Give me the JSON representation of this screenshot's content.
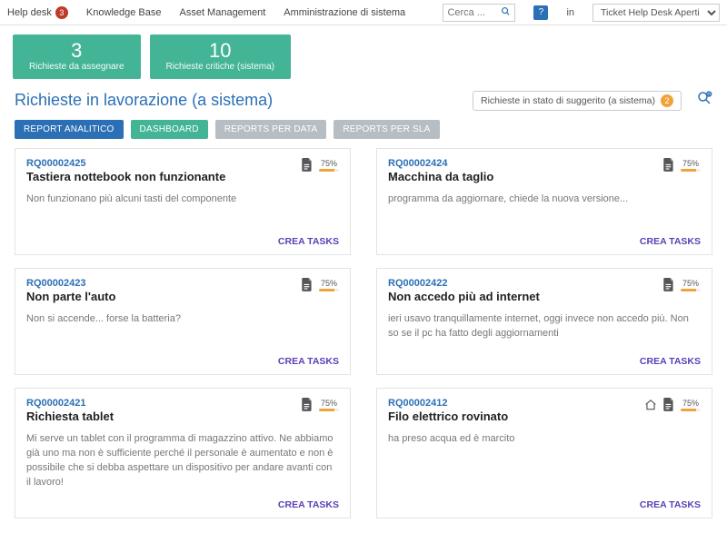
{
  "nav": {
    "items": [
      {
        "label": "Help desk",
        "badge": "3"
      },
      {
        "label": "Knowledge Base"
      },
      {
        "label": "Asset Management"
      },
      {
        "label": "Amministrazione di sistema"
      }
    ],
    "search_placeholder": "Cerca ...",
    "help_label": "?",
    "in_label": "in",
    "scope_value": "Ticket Help Desk Aperti"
  },
  "summary": [
    {
      "value": "3",
      "label": "Richieste da assegnare"
    },
    {
      "value": "10",
      "label": "Richieste critiche (sistema)"
    }
  ],
  "section": {
    "title": "Richieste in lavorazione (a sistema)",
    "suggerito_label": "Richieste in stato di suggerito (a sistema)",
    "suggerito_count": "2"
  },
  "tabs": [
    {
      "label": "REPORT ANALITICO",
      "kind": "blue"
    },
    {
      "label": "DASHBOARD",
      "kind": "green"
    },
    {
      "label": "REPORTS PER DATA",
      "kind": "grey"
    },
    {
      "label": "REPORTS PER SLA",
      "kind": "grey"
    }
  ],
  "pct_label": "75%",
  "create_label": "CREA TASKS",
  "cards": [
    {
      "id": "RQ00002425",
      "title": "Tastiera nottebook non funzionante",
      "desc": "Non funzionano più alcuni tasti del componente",
      "pct": 75,
      "extra_icon": false
    },
    {
      "id": "RQ00002424",
      "title": "Macchina da taglio",
      "desc": "programma da aggiornare, chiede la nuova versione...",
      "pct": 75,
      "extra_icon": false
    },
    {
      "id": "RQ00002423",
      "title": "Non parte l'auto",
      "desc": "Non si accende... forse la batteria?",
      "pct": 75,
      "extra_icon": false
    },
    {
      "id": "RQ00002422",
      "title": "Non accedo più ad internet",
      "desc": "ieri usavo tranquillamente internet, oggi invece non accedo più. Non so se il pc ha fatto degli aggiornamenti",
      "pct": 75,
      "extra_icon": false
    },
    {
      "id": "RQ00002421",
      "title": "Richiesta tablet",
      "desc": "Mi serve un tablet con il programma di magazzino attivo. Ne abbiamo già uno ma non è sufficiente perché il personale è aumentato e non è possibile che si debba aspettare un dispositivo per andare avanti con il lavoro!",
      "pct": 75,
      "extra_icon": false
    },
    {
      "id": "RQ00002412",
      "title": "Filo elettrico rovinato",
      "desc": "ha preso acqua ed è marcito",
      "pct": 75,
      "extra_icon": true
    }
  ]
}
